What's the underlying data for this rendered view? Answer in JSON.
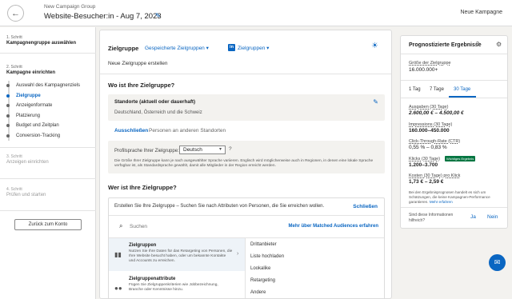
{
  "header": {
    "back_icon": "arrow-left-icon",
    "group_label": "New Campaign Group",
    "campaign_title": "Website-Besucher:in - Aug 7, 2023",
    "edit_icon": "pencil-icon",
    "account_name": "Neue Kampagne"
  },
  "steps": [
    {
      "num": "1. Schritt",
      "title": "Kampagnengruppe auswählen"
    },
    {
      "num": "2. Schritt",
      "title": "Kampagne einrichten"
    },
    {
      "num": "3. Schritt",
      "title": "Anzeigen einrichten"
    },
    {
      "num": "4. Schritt",
      "title": "Prüfen und starten"
    }
  ],
  "substeps": [
    {
      "label": "Auswahl des Kampagnenziels",
      "active": false
    },
    {
      "label": "Zielgruppe",
      "active": true
    },
    {
      "label": "Anzeigenformate",
      "active": false
    },
    {
      "label": "Platzierung",
      "active": false
    },
    {
      "label": "Budget und Zeitplan",
      "active": false
    },
    {
      "label": "Conversion-Tracking",
      "active": false
    }
  ],
  "back_to_account": "Zurück zum Konto",
  "targeting": {
    "title": "Zielgruppe",
    "saved_audiences": "Gespeicherte Zielgruppen ▾",
    "platform_badge": "in",
    "audiences_dropdown": "Zielgruppen ▾",
    "new_audience": "Neue Zielgruppe erstellen",
    "where_title": "Wo ist Ihre Zielgruppe?",
    "locations_title": "Standorte (aktuell oder dauerhaft)",
    "locations_values": "Deutschland, Österreich und die Schweiz",
    "exclude_label": "Ausschließen",
    "other_locations": "Personen an anderen Standorten",
    "profile_lang_label": "Profilsprache Ihrer Zielgruppe:",
    "profile_lang_value": "Deutsch",
    "profile_lang_help": "Die Größe Ihrer Zielgruppe kann je nach ausgewählter Sprache variieren. Englisch wird möglicherweise auch in Regionen, in denen eine lokale Sprache verfügbar ist, als Standardsprache gewählt, damit alle Mitglieder in der Region erreicht werden.",
    "who_title": "Wer ist Ihre Zielgruppe?",
    "audience_hint": "Erstellen Sie Ihre Zielgruppe – Suchen Sie nach Attributen von Personen, die Sie erreichen wollen.",
    "close_label": "Schließen",
    "search_placeholder": "Suchen",
    "matched_link": "Mehr über Matched Audiences erfahren",
    "categories": [
      {
        "title": "Zielgruppen",
        "desc": "Nutzen Sie Ihre Daten für das Retargeting von Personen, die Ihre Website besucht haben, oder um bekannte Kontakte und Accounts zu erreichen."
      },
      {
        "title": "Zielgruppenattribute",
        "desc": "Fügen Sie Zielgruppenkriterien wie Jobbezeichnung, Branche oder Kenntnisse hinzu."
      }
    ],
    "sub_options": [
      "Drittanbieter",
      "Liste hochladen",
      "Lookalike",
      "Retargeting",
      "Andere"
    ]
  },
  "forecast": {
    "title": "Prognostizierte Ergebnisse",
    "audience_size_label": "Größe der Zielgruppe",
    "audience_size_value": "16.000.000+",
    "tabs": [
      "1 Tag",
      "7 Tage",
      "30 Tage"
    ],
    "spend_label": "Ausgaben (30 Tage)",
    "spend_value": "2.600,00 € – 4.500,00 €",
    "impressions_label": "Impressions (30 Tage)",
    "impressions_value": "160.000–450.000",
    "ctr_label": "Click-Through-Rate (CTR)",
    "ctr_value": "0,55 % – 0,83 %",
    "clicks_label": "Klicks (30 Tage)",
    "clicks_badge": "Wichtiges Ergebnis",
    "clicks_value": "1.200–3.700",
    "cpc_label": "Kosten (30 Tage) pro Klick",
    "cpc_value": "1,73 € – 2,59 €",
    "note": "Bei den Ergebnisprognosen handelt es sich um Schätzungen, die keine Kampagnen-Performance garantieren.",
    "note_link": "Mehr erfahren",
    "feedback_q": "Sind diese Informationen hilfreich?",
    "yes": "Ja",
    "no": "Nein"
  },
  "colors": {
    "accent": "#0a66c2",
    "success": "#057642",
    "background": "#f3f2ef"
  }
}
